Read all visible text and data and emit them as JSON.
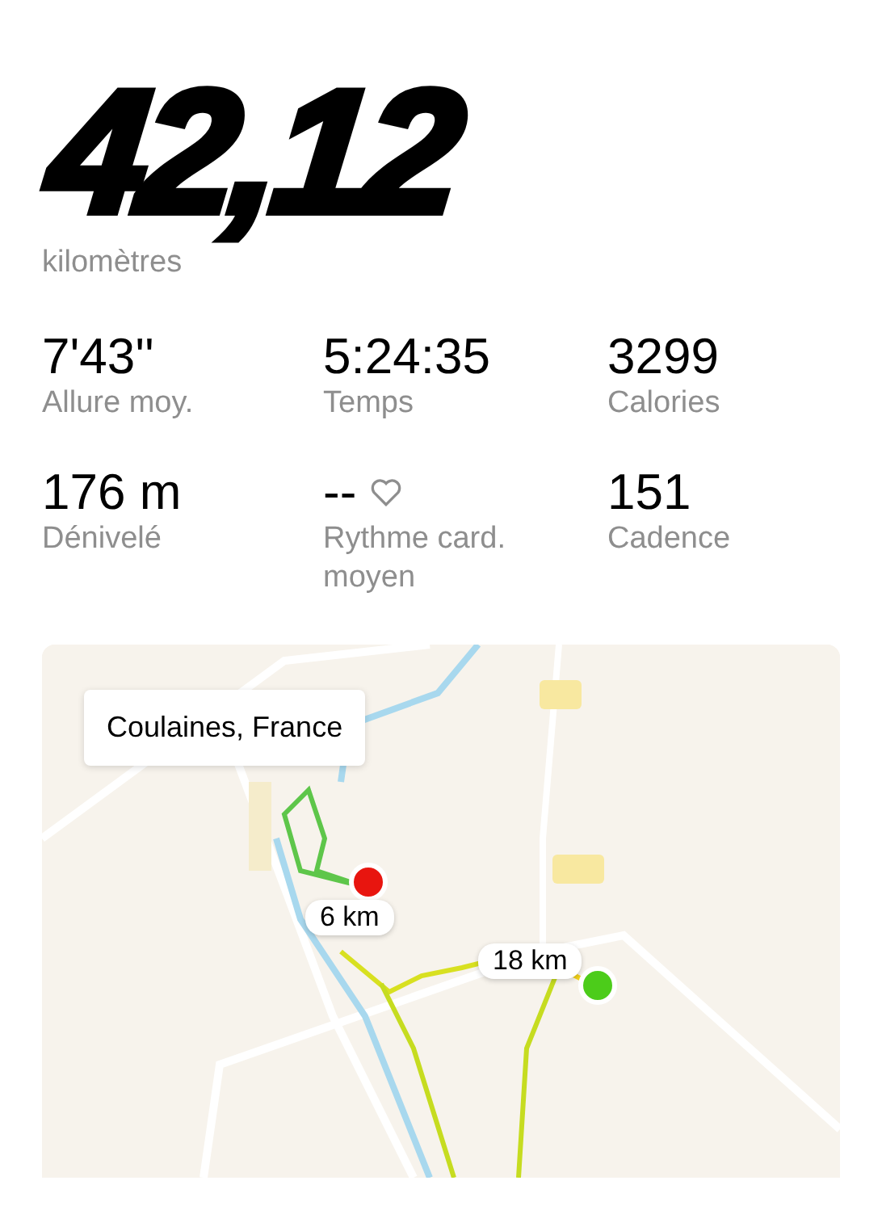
{
  "distance": {
    "value": "42,12",
    "unit": "kilomètres"
  },
  "stats": [
    {
      "kind": "plain",
      "value": "7'43''",
      "label": "Allure moy."
    },
    {
      "kind": "plain",
      "value": "5:24:35",
      "label": "Temps"
    },
    {
      "kind": "plain",
      "value": "3299",
      "label": "Calories"
    },
    {
      "kind": "plain",
      "value": "176 m",
      "label": "Dénivelé"
    },
    {
      "kind": "heart_rate",
      "value": "--",
      "label": "Rythme card. moyen"
    },
    {
      "kind": "plain",
      "value": "151",
      "label": "Cadence"
    }
  ],
  "map": {
    "kind": "picture",
    "location": "Coulaines, France",
    "markers": [
      {
        "kind": "end",
        "color": "#e8150f"
      },
      {
        "kind": "start",
        "color": "#4ccc1a"
      }
    ],
    "distance_labels": [
      "6 km",
      "18 km"
    ]
  }
}
